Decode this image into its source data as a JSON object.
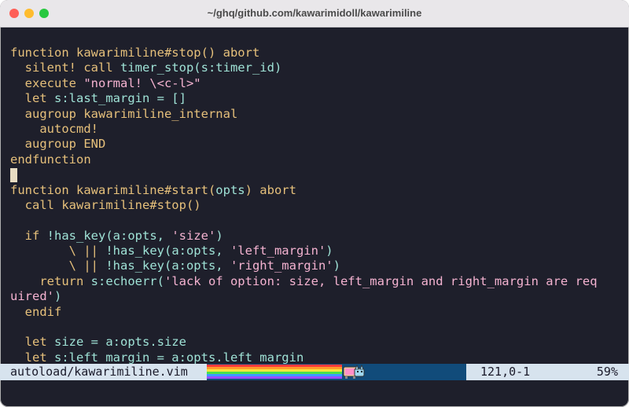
{
  "window": {
    "title": "~/ghq/github.com/kawarimidoll/kawarimiline"
  },
  "code": [
    [
      {
        "t": "function kawarimiline#stop() abort",
        "c": "kw"
      }
    ],
    [
      {
        "t": "  silent! call ",
        "c": "kw"
      },
      {
        "t": "timer_stop(s:timer_id)",
        "c": "fn"
      }
    ],
    [
      {
        "t": "  execute ",
        "c": "kw"
      },
      {
        "t": "\"normal! \\<c-l>\"",
        "c": "str"
      }
    ],
    [
      {
        "t": "  let ",
        "c": "kw"
      },
      {
        "t": "s:last_margin = []",
        "c": "fn"
      }
    ],
    [
      {
        "t": "  augroup kawarimiline_internal",
        "c": "kw"
      }
    ],
    [
      {
        "t": "    autocmd!",
        "c": "kw"
      }
    ],
    [
      {
        "t": "  augroup END",
        "c": "kw"
      }
    ],
    [
      {
        "t": "endfunction",
        "c": "kw"
      }
    ],
    [
      {
        "t": "",
        "c": "cursor"
      }
    ],
    [
      {
        "t": "function kawarimiline#start(",
        "c": "kw"
      },
      {
        "t": "opts",
        "c": "fn"
      },
      {
        "t": ") abort",
        "c": "kw"
      }
    ],
    [
      {
        "t": "  call kawarimiline#stop()",
        "c": "kw"
      }
    ],
    [
      {
        "t": "",
        "c": "kw"
      }
    ],
    [
      {
        "t": "  if ",
        "c": "kw"
      },
      {
        "t": "!has_key(a:opts, ",
        "c": "fn"
      },
      {
        "t": "'size'",
        "c": "str"
      },
      {
        "t": ")",
        "c": "fn"
      }
    ],
    [
      {
        "t": "        \\ || ",
        "c": "kw"
      },
      {
        "t": "!has_key(a:opts, ",
        "c": "fn"
      },
      {
        "t": "'left_margin'",
        "c": "str"
      },
      {
        "t": ")",
        "c": "fn"
      }
    ],
    [
      {
        "t": "        \\ || ",
        "c": "kw"
      },
      {
        "t": "!has_key(a:opts, ",
        "c": "fn"
      },
      {
        "t": "'right_margin'",
        "c": "str"
      },
      {
        "t": ")",
        "c": "fn"
      }
    ],
    [
      {
        "t": "    return ",
        "c": "kw"
      },
      {
        "t": "s:echoerr(",
        "c": "fn"
      },
      {
        "t": "'lack of option: size, left_margin and right_margin are req",
        "c": "str"
      }
    ],
    [
      {
        "t": "uired'",
        "c": "str"
      },
      {
        "t": ")",
        "c": "fn"
      }
    ],
    [
      {
        "t": "  endif",
        "c": "kw"
      }
    ],
    [
      {
        "t": "",
        "c": "kw"
      }
    ],
    [
      {
        "t": "  let ",
        "c": "kw"
      },
      {
        "t": "size = a:opts.size",
        "c": "fn"
      }
    ],
    [
      {
        "t": "  let ",
        "c": "kw"
      },
      {
        "t": "s:left_margin = a:opts.left_margin",
        "c": "fn"
      }
    ]
  ],
  "statusline": {
    "filename": "autoload/kawarimiline.vim",
    "position": "121,0-1",
    "percent": "59%"
  },
  "colors": {
    "background": "#1e1f2b",
    "keyword": "#e6c07b",
    "identifier": "#9fe2d6",
    "string": "#f5b3d1",
    "statusline_bg": "#d7e3ee",
    "statusline_mid": "#114b7a"
  }
}
